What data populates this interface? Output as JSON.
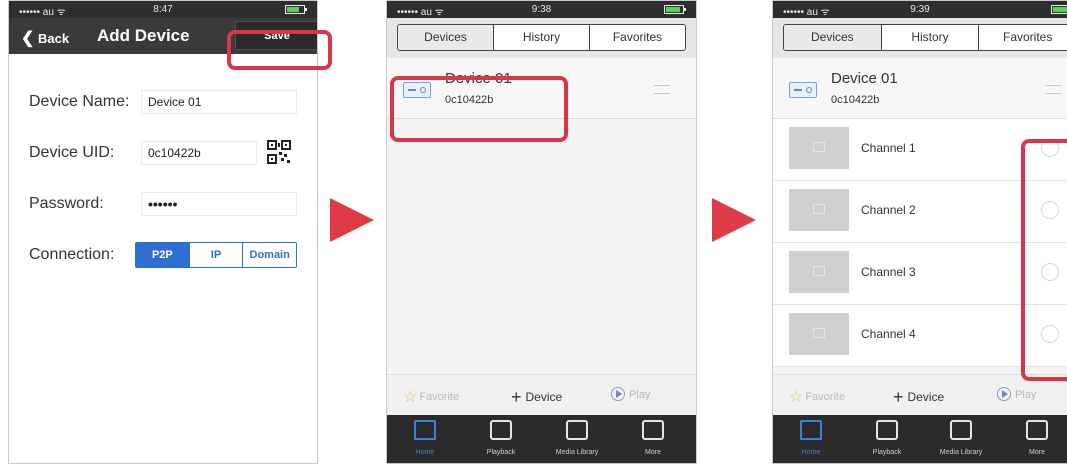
{
  "colors": {
    "accent": "#d8364a",
    "arrow": "#de3b47",
    "segment_blue": "#2e6fd2",
    "navbar": "#3a3a3a"
  },
  "screen1": {
    "status": {
      "carrier": "•••••• au ᯤ",
      "time": "8:47"
    },
    "nav": {
      "back_label": "Back",
      "title": "Add Device",
      "save_label": "Save"
    },
    "fields": [
      {
        "label": "Device Name:",
        "value": "Device 01"
      },
      {
        "label": "Device UID:",
        "value": "0c10422b",
        "icon": "qr-code-icon"
      },
      {
        "label": "Password:",
        "value": "••••••"
      }
    ],
    "connection": {
      "label": "Connection:",
      "options": [
        "P2P",
        "IP",
        "Domain"
      ],
      "selected": "P2P"
    }
  },
  "screen2": {
    "status": {
      "carrier": "•••••• au ᯤ",
      "time": "9:38"
    },
    "tabs": [
      "Devices",
      "History",
      "Favorites"
    ],
    "active_tab": "Devices",
    "device": {
      "name": "Device 01",
      "uid": "0c10422b"
    },
    "actions": {
      "favorite": "Favorite",
      "device": "Device",
      "play": "Play"
    },
    "tabbar": [
      "Home",
      "Playback",
      "Media Library",
      "More"
    ]
  },
  "screen3": {
    "status": {
      "carrier": "•••••• au ᯤ",
      "time": "9:39"
    },
    "tabs": [
      "Devices",
      "History",
      "Favorites"
    ],
    "device": {
      "name": "Device 01",
      "uid": "0c10422b"
    },
    "channels": [
      "Channel 1",
      "Channel 2",
      "Channel 3",
      "Channel 4"
    ],
    "actions": {
      "favorite": "Favorite",
      "device": "Device",
      "play": "Play"
    },
    "tabbar": [
      "Home",
      "Playback",
      "Media Library",
      "More"
    ]
  }
}
